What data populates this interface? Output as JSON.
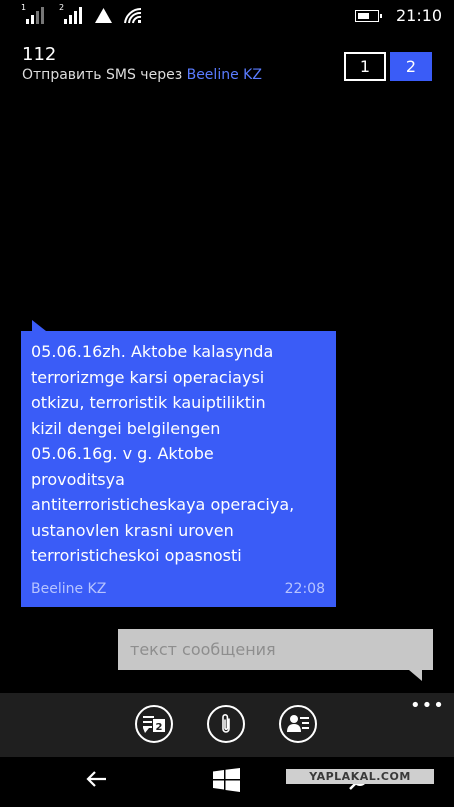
{
  "status_bar": {
    "sim1_label": "1",
    "sim2_label": "2",
    "battery_level": 0.6,
    "time": "21:10"
  },
  "header": {
    "contact_number": "112",
    "send_via_prefix": "Отправить SMS через",
    "carrier": "Beeline KZ",
    "sim_options": [
      "1",
      "2"
    ],
    "active_sim": "2"
  },
  "message": {
    "lines": [
      "05.06.16zh. Aktobe kalasynda",
      "terrorizmge karsi operaciaysi",
      "otkizu, terroristik kauiptiliktin",
      "kizil dengei belgilengen",
      "05.06.16g. v g. Aktobe",
      "provoditsya",
      "antiterroristicheskaya operaciya,",
      "ustanovlen krasni uroven",
      "terroristicheskoi opasnosti"
    ],
    "sender": "Beeline KZ",
    "time": "22:08"
  },
  "compose": {
    "placeholder": "текст сообщения",
    "value": ""
  },
  "app_bar": {
    "sim_button_badge": "2",
    "more_label": "•••"
  },
  "watermark": "YAPLAKAL.COM",
  "colors": {
    "accent": "#3a5cf7",
    "background": "#000000",
    "compose_bg": "#c7c7c7",
    "appbar_bg": "#1f1f1f",
    "carrier_link": "#5a7cff"
  }
}
